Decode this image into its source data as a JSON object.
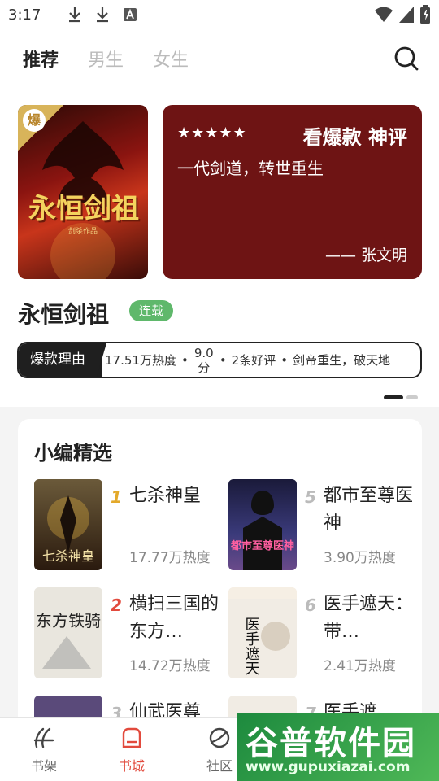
{
  "status_bar": {
    "time": "3:17"
  },
  "top_nav": {
    "tabs": [
      {
        "label": "推荐",
        "active": true
      },
      {
        "label": "男生",
        "active": false
      },
      {
        "label": "女生",
        "active": false
      }
    ]
  },
  "featured": {
    "badge": "爆",
    "cover_title": "永恒剑祖",
    "cover_author": "剑杀作品",
    "review_stars": 5,
    "review_title": "看爆款 神评",
    "review_text": "一代剑道，转世重生",
    "review_author": "—— 张文明",
    "book_title": "永恒剑祖",
    "status": "连载",
    "reason_label": "爆款理由",
    "reason_heat": "17.51万热度",
    "reason_score": "9.0 分",
    "reason_comments": "2条好评",
    "reason_tag": "剑帝重生，破天地"
  },
  "editor_picks": {
    "title": "小编精选",
    "items": [
      {
        "rank": "1",
        "title": "七杀神皇",
        "heat": "17.77万热度",
        "cover_text": "七杀神皇",
        "cover_color": "#3a2a18"
      },
      {
        "rank": "5",
        "title": "都市至尊医神",
        "heat": "3.90万热度",
        "cover_text": "都市至尊医神",
        "cover_color": "#2a2a5a"
      },
      {
        "rank": "2",
        "title": "横扫三国的东方…",
        "heat": "14.72万热度",
        "cover_text": "东方铁骑",
        "cover_color": "#e9e6de"
      },
      {
        "rank": "6",
        "title": "医手遮天：带…",
        "heat": "2.41万热度",
        "cover_text": "医手遮天",
        "cover_color": "#f1ece4"
      },
      {
        "rank": "3",
        "title": "仙武医尊",
        "heat": "",
        "cover_text": "",
        "cover_color": "#5a4a7a"
      },
      {
        "rank": "7",
        "title": "医手遮",
        "heat": "",
        "cover_text": "",
        "cover_color": "#f1ece4"
      }
    ]
  },
  "bottom_nav": [
    {
      "label": "书架",
      "active": false
    },
    {
      "label": "书城",
      "active": true
    },
    {
      "label": "社区",
      "active": false
    }
  ],
  "watermark": {
    "text": "谷普软件园",
    "url": "www.gupuxiazai.com"
  },
  "colors": {
    "accent": "#e24a3d",
    "review_bg": "#6e1414",
    "status_green": "#5fb86b",
    "gold_rank": "#e3a92b"
  }
}
